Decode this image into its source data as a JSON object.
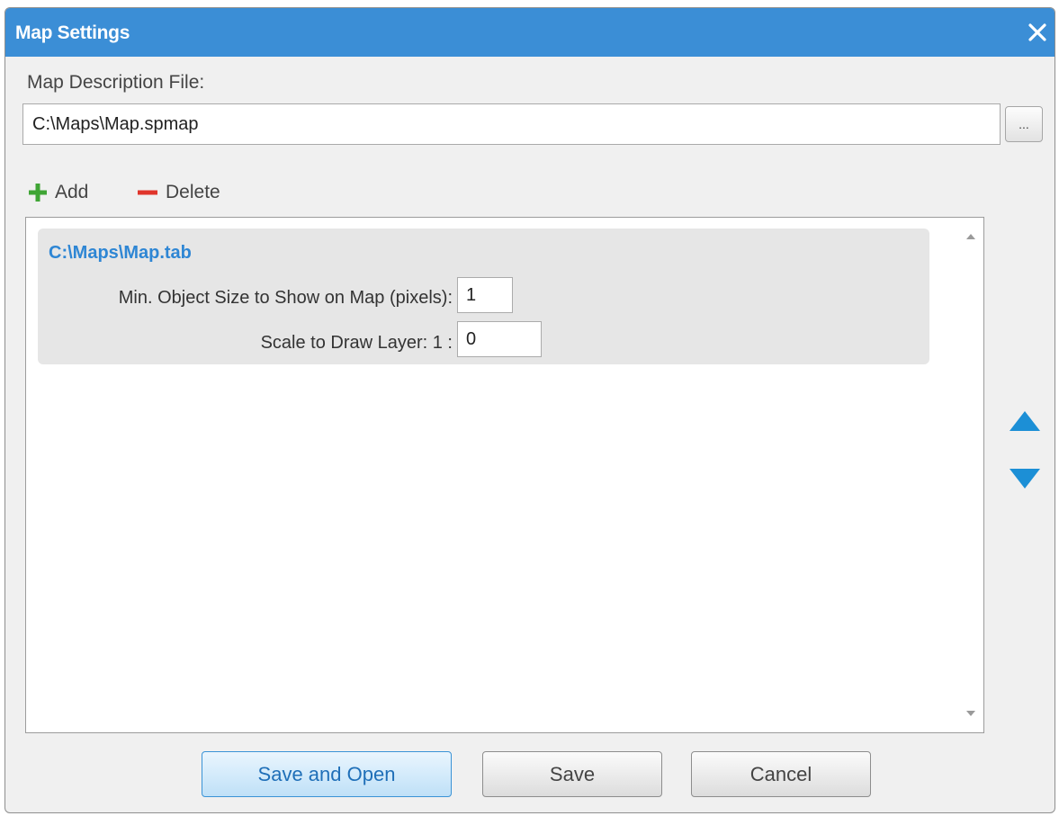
{
  "window": {
    "title": "Map Settings"
  },
  "file": {
    "label": "Map Description File:",
    "value": "C:\\Maps\\Map.spmap",
    "browse_label": "..."
  },
  "toolbar": {
    "add_label": "Add",
    "delete_label": "Delete"
  },
  "layers": [
    {
      "name": "C:\\Maps\\Map.tab",
      "min_size_label": "Min. Object Size to Show on Map (pixels):",
      "min_size_value": "1",
      "scale_label": "Scale to Draw Layer: 1 :",
      "scale_value": "0"
    }
  ],
  "buttons": {
    "save_and_open": "Save and Open",
    "save": "Save",
    "cancel": "Cancel"
  },
  "colors": {
    "titlebar": "#3b8ed6",
    "accent": "#1c8fd6",
    "add_icon": "#3fa535",
    "delete_icon": "#e0352b",
    "layer_name": "#2e86d4"
  },
  "icons": {
    "close": "close-icon",
    "add": "plus-icon",
    "delete": "minus-icon",
    "move_up": "triangle-up-icon",
    "move_down": "triangle-down-icon"
  }
}
